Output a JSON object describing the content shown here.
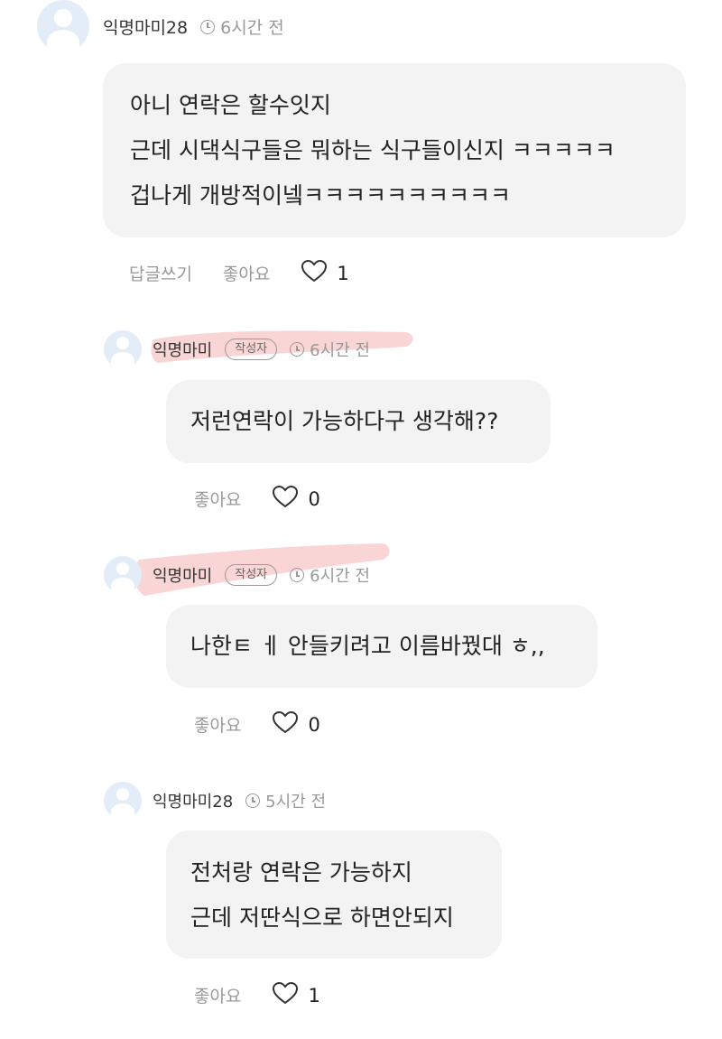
{
  "comments": [
    {
      "author": "익명마미28",
      "badge": "",
      "time": "6시간 전",
      "lines": [
        "아니 연락은 할수잇지",
        "근데 시댁식구들은 뭐하는 식구들이신지 ㅋㅋㅋㅋㅋ",
        "겁나게 개방적이넼ㅋㅋㅋㅋㅋㅋㅋㅋㅋㅋ"
      ],
      "reply_label": "답글쓰기",
      "like_label": "좋아요",
      "like_count": "1"
    },
    {
      "author": "익명마미",
      "badge": "작성자",
      "time": "6시간 전",
      "lines": [
        "저런연락이 가능하다구 생각해??"
      ],
      "like_label": "좋아요",
      "like_count": "0"
    },
    {
      "author": "익명마미",
      "badge": "작성자",
      "time": "6시간 전",
      "lines": [
        "나한ㅌ ㅔ 안들키려고 이름바꿨대 ㅎ,,"
      ],
      "like_label": "좋아요",
      "like_count": "0"
    },
    {
      "author": "익명마미28",
      "badge": "",
      "time": "5시간 전",
      "lines": [
        "전처랑 연락은 가능하지",
        "근데 저딴식으로 하면안되지"
      ],
      "like_label": "좋아요",
      "like_count": "1"
    }
  ],
  "colors": {
    "bubble": "#f3f3f3",
    "meta": "#999999",
    "avatar": "#e3edf7",
    "highlight": "#f6b3b3"
  }
}
